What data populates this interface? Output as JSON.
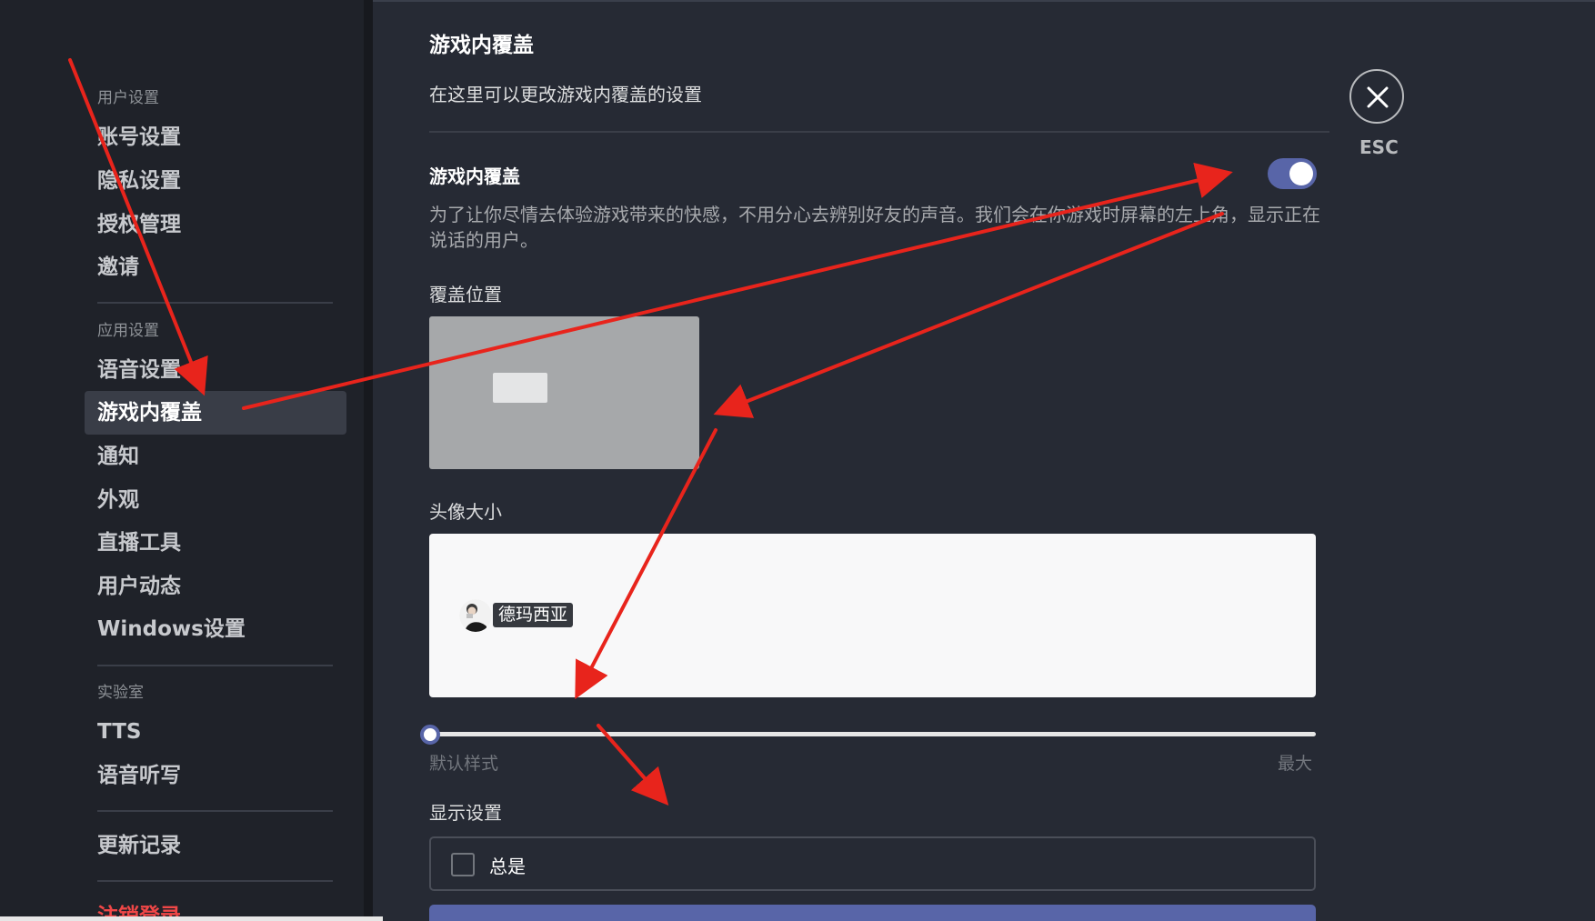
{
  "sidebar": {
    "sections": [
      {
        "header": "用户设置",
        "items": [
          "账号设置",
          "隐私设置",
          "授权管理",
          "邀请"
        ]
      },
      {
        "header": "应用设置",
        "items": [
          "语音设置",
          "游戏内覆盖",
          "通知",
          "外观",
          "直播工具",
          "用户动态",
          "Windows设置"
        ]
      },
      {
        "header": "实验室",
        "items": [
          "TTS",
          "语音听写"
        ]
      },
      {
        "header": "",
        "items": [
          "更新记录"
        ]
      },
      {
        "header": "",
        "items": [
          "注销登录"
        ]
      }
    ],
    "active_item": "游戏内覆盖"
  },
  "main": {
    "title": "游戏内覆盖",
    "subtitle": "在这里可以更改游戏内覆盖的设置",
    "overlay_toggle": {
      "label": "游戏内覆盖",
      "enabled": true,
      "description": "为了让你尽情去体验游戏带来的快感，不用分心去辨别好友的声音。我们会在你游戏时屏幕的左上角，显示正在说话的用户。"
    },
    "position": {
      "label": "覆盖位置"
    },
    "avatar_size": {
      "label": "头像大小",
      "preview_user": "德玛西亚",
      "slider_value": 0,
      "min_label": "默认样式",
      "max_label": "最大"
    },
    "display": {
      "label": "显示设置",
      "option": "总是",
      "checked": false
    }
  },
  "close": {
    "label": "ESC"
  },
  "colors": {
    "background": "#262a34",
    "sidebar": "#1f2229",
    "accent": "#5865a8",
    "annotation": "#e8241c"
  }
}
